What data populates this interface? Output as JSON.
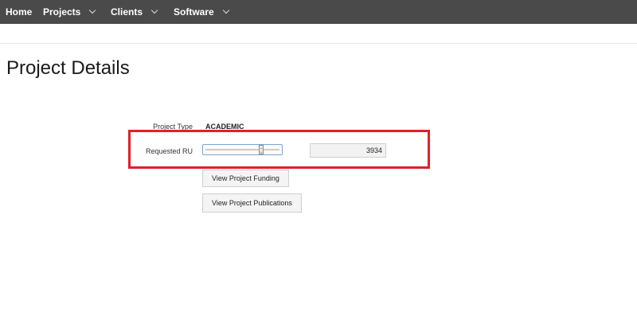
{
  "nav": {
    "home": "Home",
    "projects": "Projects",
    "clients": "Clients",
    "software": "Software"
  },
  "page": {
    "title": "Project Details"
  },
  "form": {
    "project_type_label": "Project Type",
    "project_type_value": "ACADEMIC",
    "requested_ru_label": "Requested RU",
    "requested_ru_value": "3934",
    "slider_level_fraction": 0.75
  },
  "buttons": {
    "view_funding": "View Project Funding",
    "view_publications": "View Project Publications"
  },
  "colors": {
    "navbar": "#4a4a4a",
    "highlight": "#e0202a",
    "slider_border": "#7aa6d6"
  }
}
